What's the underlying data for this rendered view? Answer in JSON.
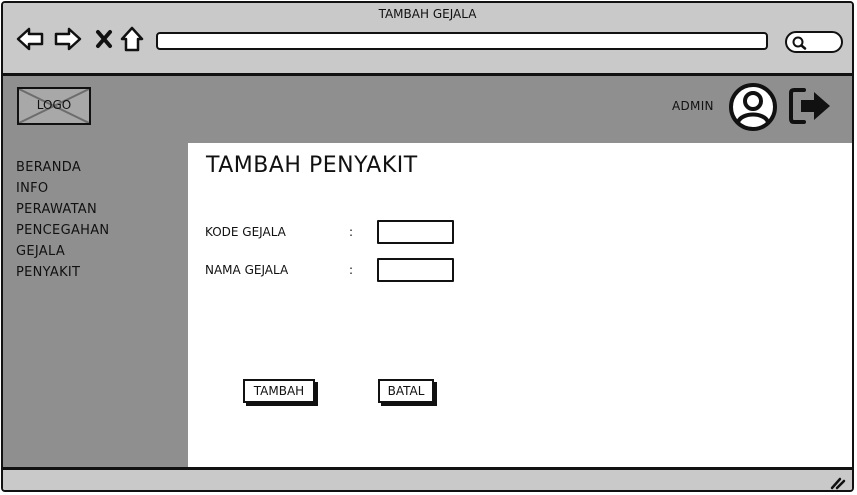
{
  "window": {
    "title": "TAMBAH GEJALA"
  },
  "browser": {
    "back_icon": "arrow-left-icon",
    "forward_icon": "arrow-right-icon",
    "stop_icon": "close-icon",
    "home_icon": "home-icon",
    "address_value": "",
    "search_icon": "search-icon"
  },
  "header": {
    "logo_text": "LOGO",
    "user_label": "ADMIN",
    "avatar_icon": "user-avatar-icon",
    "logout_icon": "logout-icon"
  },
  "sidebar": {
    "items": [
      {
        "label": "BERANDA"
      },
      {
        "label": "INFO"
      },
      {
        "label": "PERAWATAN"
      },
      {
        "label": "PENCEGAHAN"
      },
      {
        "label": "GEJALA"
      },
      {
        "label": "PENYAKIT"
      }
    ]
  },
  "form": {
    "title": "TAMBAH PENYAKIT",
    "fields": [
      {
        "label": "KODE GEJALA",
        "colon": ":",
        "value": ""
      },
      {
        "label": "NAMA GEJALA",
        "colon": ":",
        "value": ""
      }
    ],
    "submit_label": "TAMBAH",
    "cancel_label": "BATAL"
  },
  "colors": {
    "chrome": "#c9c9c9",
    "panel": "#8f8f8f",
    "border": "#111111"
  }
}
